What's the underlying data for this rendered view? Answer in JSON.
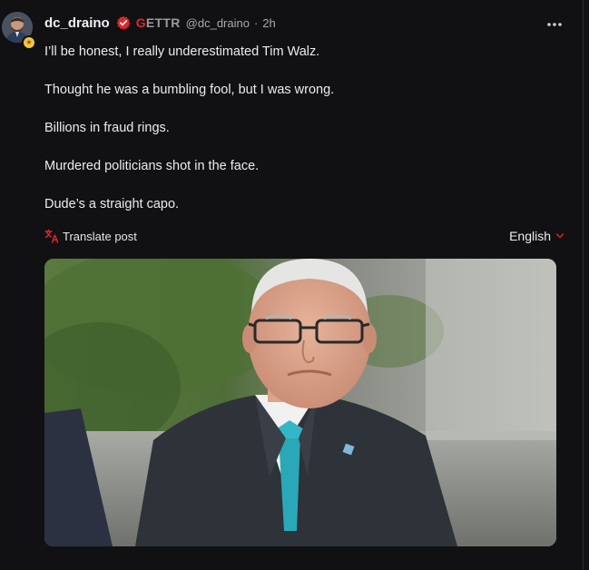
{
  "post": {
    "username": "dc_draino",
    "brand": "GETTR",
    "handle": "@dc_draino",
    "separator": "·",
    "time": "2h",
    "more_icon": "more-horizontal-icon",
    "paragraphs": [
      "I’ll be honest, I really underestimated Tim Walz.",
      "Thought he was a bumbling fool, but I was wrong.",
      "Billions in fraud rings.",
      "Murdered politicians shot in the face.",
      "Dude’s a straight capo."
    ],
    "translate_label": "Translate post",
    "language": "English"
  },
  "colors": {
    "background": "#111113",
    "accent_red": "#e0262d",
    "text": "#ececee",
    "muted": "#a9a9ae"
  }
}
